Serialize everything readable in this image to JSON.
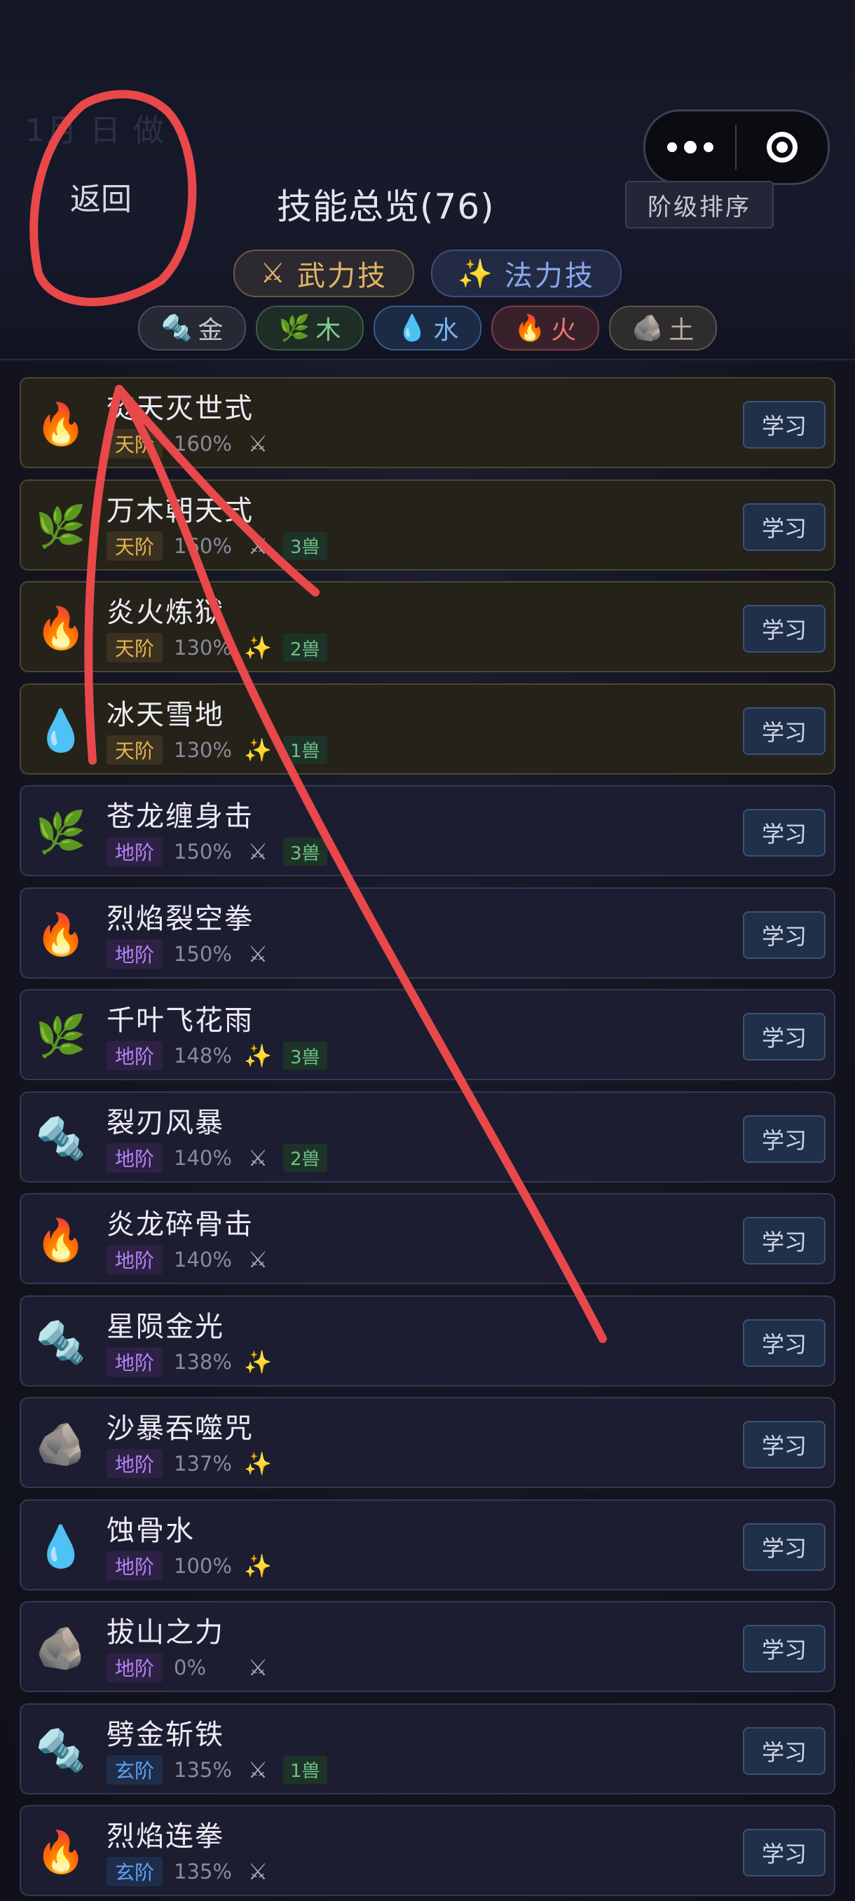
{
  "header": {
    "ghost_date": "1月  日  做",
    "back_label": "返回",
    "title": "技能总览(76)",
    "sort_label": "阶级排序",
    "capsule": {
      "menu_icon": "more-dots-icon",
      "close_icon": "target-circle-icon"
    }
  },
  "type_tabs": [
    {
      "icon": "⚔",
      "label": "武力技"
    },
    {
      "icon": "✨",
      "label": "法力技"
    }
  ],
  "element_tabs": [
    {
      "icon": "🔩",
      "label": "金"
    },
    {
      "icon": "🌿",
      "label": "木"
    },
    {
      "icon": "💧",
      "label": "水"
    },
    {
      "icon": "🔥",
      "label": "火"
    },
    {
      "icon": "🪨",
      "label": "土"
    }
  ],
  "learn_label": "学习",
  "skills": [
    {
      "name": "焚天灭世式",
      "element": "🔥",
      "tier": "天阶",
      "tier_class": "tian",
      "pct": "160%",
      "type": "⚔",
      "type_class": "phys",
      "beast": ""
    },
    {
      "name": "万木朝天式",
      "element": "🌿",
      "tier": "天阶",
      "tier_class": "tian",
      "pct": "160%",
      "type": "⚔",
      "type_class": "phys",
      "beast": "3兽"
    },
    {
      "name": "炎火炼狱",
      "element": "🔥",
      "tier": "天阶",
      "tier_class": "tian",
      "pct": "130%",
      "type": "✨",
      "type_class": "magic",
      "beast": "2兽"
    },
    {
      "name": "冰天雪地",
      "element": "💧",
      "tier": "天阶",
      "tier_class": "tian",
      "pct": "130%",
      "type": "✨",
      "type_class": "magic",
      "beast": "1兽"
    },
    {
      "name": "苍龙缠身击",
      "element": "🌿",
      "tier": "地阶",
      "tier_class": "di",
      "pct": "150%",
      "type": "⚔",
      "type_class": "phys",
      "beast": "3兽"
    },
    {
      "name": "烈焰裂空拳",
      "element": "🔥",
      "tier": "地阶",
      "tier_class": "di",
      "pct": "150%",
      "type": "⚔",
      "type_class": "phys",
      "beast": ""
    },
    {
      "name": "千叶飞花雨",
      "element": "🌿",
      "tier": "地阶",
      "tier_class": "di",
      "pct": "148%",
      "type": "✨",
      "type_class": "magic",
      "beast": "3兽"
    },
    {
      "name": "裂刃风暴",
      "element": "🔩",
      "tier": "地阶",
      "tier_class": "di",
      "pct": "140%",
      "type": "⚔",
      "type_class": "phys",
      "beast": "2兽"
    },
    {
      "name": "炎龙碎骨击",
      "element": "🔥",
      "tier": "地阶",
      "tier_class": "di",
      "pct": "140%",
      "type": "⚔",
      "type_class": "phys",
      "beast": ""
    },
    {
      "name": "星陨金光",
      "element": "🔩",
      "tier": "地阶",
      "tier_class": "di",
      "pct": "138%",
      "type": "✨",
      "type_class": "magic",
      "beast": ""
    },
    {
      "name": "沙暴吞噬咒",
      "element": "🪨",
      "tier": "地阶",
      "tier_class": "di",
      "pct": "137%",
      "type": "✨",
      "type_class": "magic",
      "beast": ""
    },
    {
      "name": "蚀骨水",
      "element": "💧",
      "tier": "地阶",
      "tier_class": "di",
      "pct": "100%",
      "type": "✨",
      "type_class": "magic",
      "beast": ""
    },
    {
      "name": "拔山之力",
      "element": "🪨",
      "tier": "地阶",
      "tier_class": "di",
      "pct": "0%",
      "type": "⚔",
      "type_class": "phys",
      "beast": ""
    },
    {
      "name": "劈金斩铁",
      "element": "🔩",
      "tier": "玄阶",
      "tier_class": "xuan",
      "pct": "135%",
      "type": "⚔",
      "type_class": "phys",
      "beast": "1兽"
    },
    {
      "name": "烈焰连拳",
      "element": "🔥",
      "tier": "玄阶",
      "tier_class": "xuan",
      "pct": "135%",
      "type": "⚔",
      "type_class": "phys",
      "beast": ""
    }
  ],
  "colors": {
    "annotation": "#e8484a",
    "tian_tier": "#e4b44e",
    "di_tier": "#b283f5",
    "xuan_tier": "#5fa0f5"
  }
}
